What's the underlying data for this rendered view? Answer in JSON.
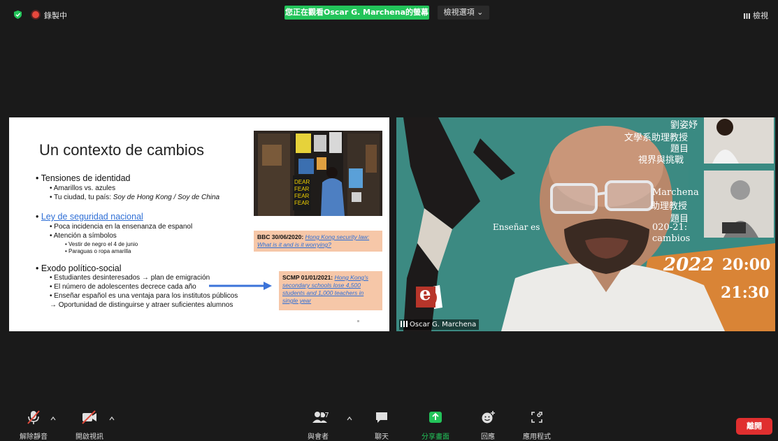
{
  "topbar": {
    "recording_label": "錄製中",
    "viewing_banner": "您正在觀看Oscar G. Marchena的螢幕",
    "view_options_label": "檢視選項 ⌄",
    "view_button_label": "檢視"
  },
  "slide": {
    "title": "Un contexto de cambios",
    "bullets": {
      "tensiones": "Tensiones de identidad",
      "amarillos": "Amarillos vs. azules",
      "ciudad_prefix": "Tu ciudad, tu país: ",
      "ciudad_italic": "Soy de Hong Kong / Soy de China",
      "ley": "Ley de seguridad nacional",
      "poca": "Poca incidencia en la ensenanza de espanol",
      "atencion": "Atención a símbolos",
      "vestir": "Vestir de negro el 4 de junio",
      "paraguas": "Paraguas o ropa amarilla",
      "exodo": "Exodo político-social",
      "estudiantes": "Estudiantes desinteresados → plan de emigración",
      "numero": "El número de adolescentes decrece cada año",
      "ensenar": "Enseñar español es una ventaja para los institutos públicos",
      "oportunidad": "→ Oportunidad de distinguirse y atraer suficientes alumnos"
    },
    "ref_bbc": {
      "source": "BBC 30/06/2020: ",
      "link": "Hong Kong security law: What is it and is it worrying?"
    },
    "ref_scmp": {
      "source": "SCMP 01/01/2021: ",
      "link": "Hong Kong's secondary schools lose 4,500 students and 1,000 teachers in single year"
    }
  },
  "video": {
    "participant_name": "Oscar G. Marchena",
    "poster": {
      "name_zh": "劉姿妤",
      "dept_zh": "文學系助理教授",
      "topic_zh": "題目",
      "subtopic_zh": "視界與挑戰",
      "name_lat": "Marchena",
      "role_zh": "助理教授",
      "topic2_zh": "題目",
      "year_span": "020-21:",
      "cambios": "cambios",
      "ensenar": "Enseñar es",
      "year": "2022",
      "time_start": "20:00",
      "time_end": "21:30",
      "logo_letter": "e"
    }
  },
  "toolbar": {
    "unmute": "解除靜音",
    "start_video": "開啟視訊",
    "participants": "與會者",
    "participants_count": "57",
    "chat": "聊天",
    "share_screen": "分享畫面",
    "reactions": "回應",
    "apps": "應用程式",
    "leave": "離開"
  },
  "colors": {
    "share_green": "#23c45a",
    "leave_red": "#e02f2f",
    "link_blue": "#2f6fd6",
    "ref_box_peach": "#f6c7a8",
    "poster_teal": "#3c8a82"
  }
}
